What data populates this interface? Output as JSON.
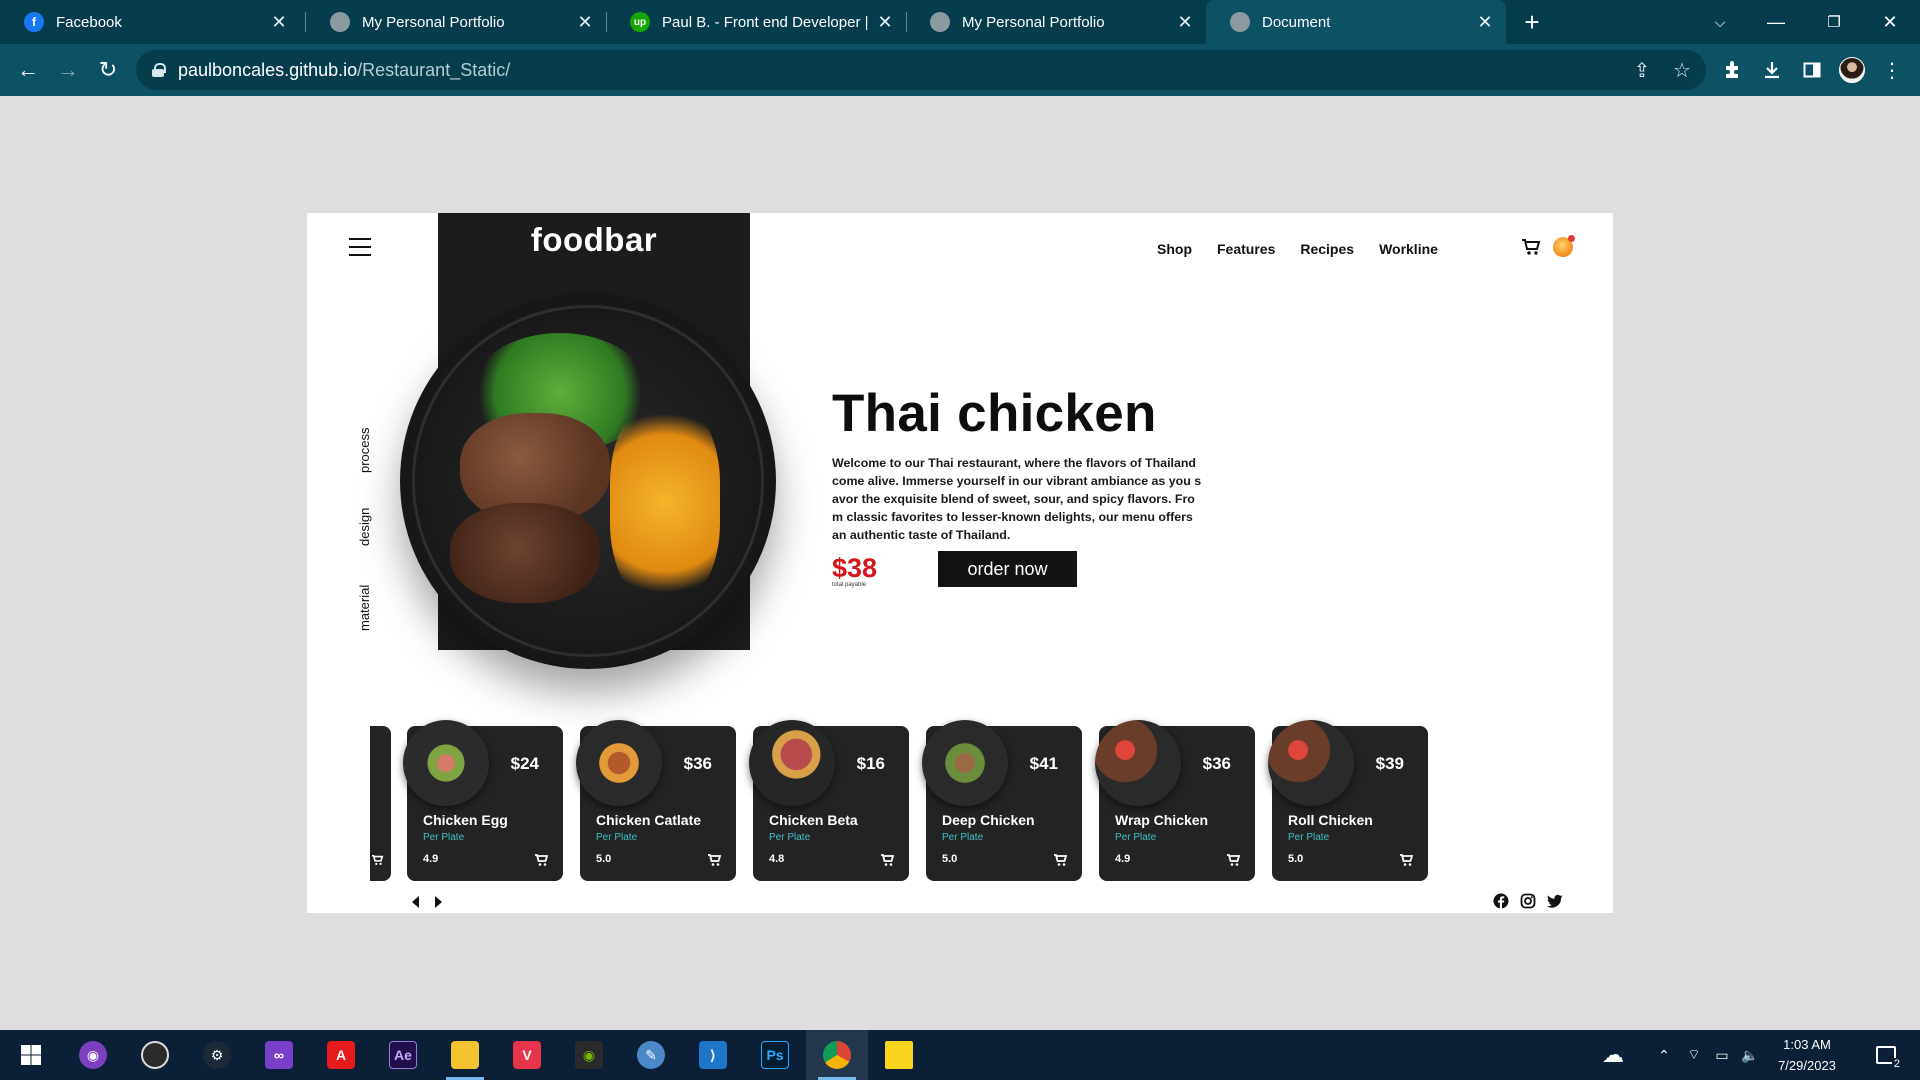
{
  "browser": {
    "tabs": [
      {
        "title": "Facebook",
        "favicon": "facebook-icon",
        "color": "#1877f2",
        "active": false
      },
      {
        "title": "My Personal Portfolio",
        "favicon": "globe-icon",
        "color": "#8a9aa0",
        "active": false
      },
      {
        "title": "Paul B. - Front end Developer | IT",
        "favicon": "upwork-icon",
        "color": "#14a800",
        "active": false
      },
      {
        "title": "My Personal Portfolio",
        "favicon": "globe-icon",
        "color": "#8a9aa0",
        "active": false
      },
      {
        "title": "Document",
        "favicon": "globe-icon",
        "color": "#8a9aa0",
        "active": true
      }
    ],
    "address": {
      "host": "paulboncales.github.io",
      "path": "/Restaurant_Static/"
    }
  },
  "site": {
    "logo": "foodbar",
    "nav": [
      "Shop",
      "Features",
      "Recipes",
      "Workline"
    ],
    "sidebar": [
      "process",
      "design",
      "material"
    ],
    "hero": {
      "title": "Thai chicken",
      "description": "Welcome to our Thai restaurant, where the flavors of Thailand come alive. Immerse yourself in our vibrant ambiance as you savor the exquisite blend of sweet, sour, and spicy flavors. From classic favorites to lesser-known delights, our menu offers an authentic taste of Thailand.",
      "price": "$38",
      "price_caption": "total payable",
      "order_button": "order now"
    },
    "cards": [
      {
        "name": "Chicken Egg",
        "price": "$24",
        "unit": "Per Plate",
        "rating": "4.9"
      },
      {
        "name": "Chicken Catlate",
        "price": "$36",
        "unit": "Per Plate",
        "rating": "5.0"
      },
      {
        "name": "Chicken Beta",
        "price": "$16",
        "unit": "Per Plate",
        "rating": "4.8"
      },
      {
        "name": "Deep Chicken",
        "price": "$41",
        "unit": "Per Plate",
        "rating": "5.0"
      },
      {
        "name": "Wrap Chicken",
        "price": "$36",
        "unit": "Per Plate",
        "rating": "4.9"
      },
      {
        "name": "Roll Chicken",
        "price": "$39",
        "unit": "Per Plate",
        "rating": "5.0"
      }
    ],
    "accent_price_color": "#d7141a",
    "accent_sub_color": "#3fc1c9"
  },
  "taskbar": {
    "time": "1:03 AM",
    "date": "7/29/2023",
    "notification_count": "2"
  }
}
